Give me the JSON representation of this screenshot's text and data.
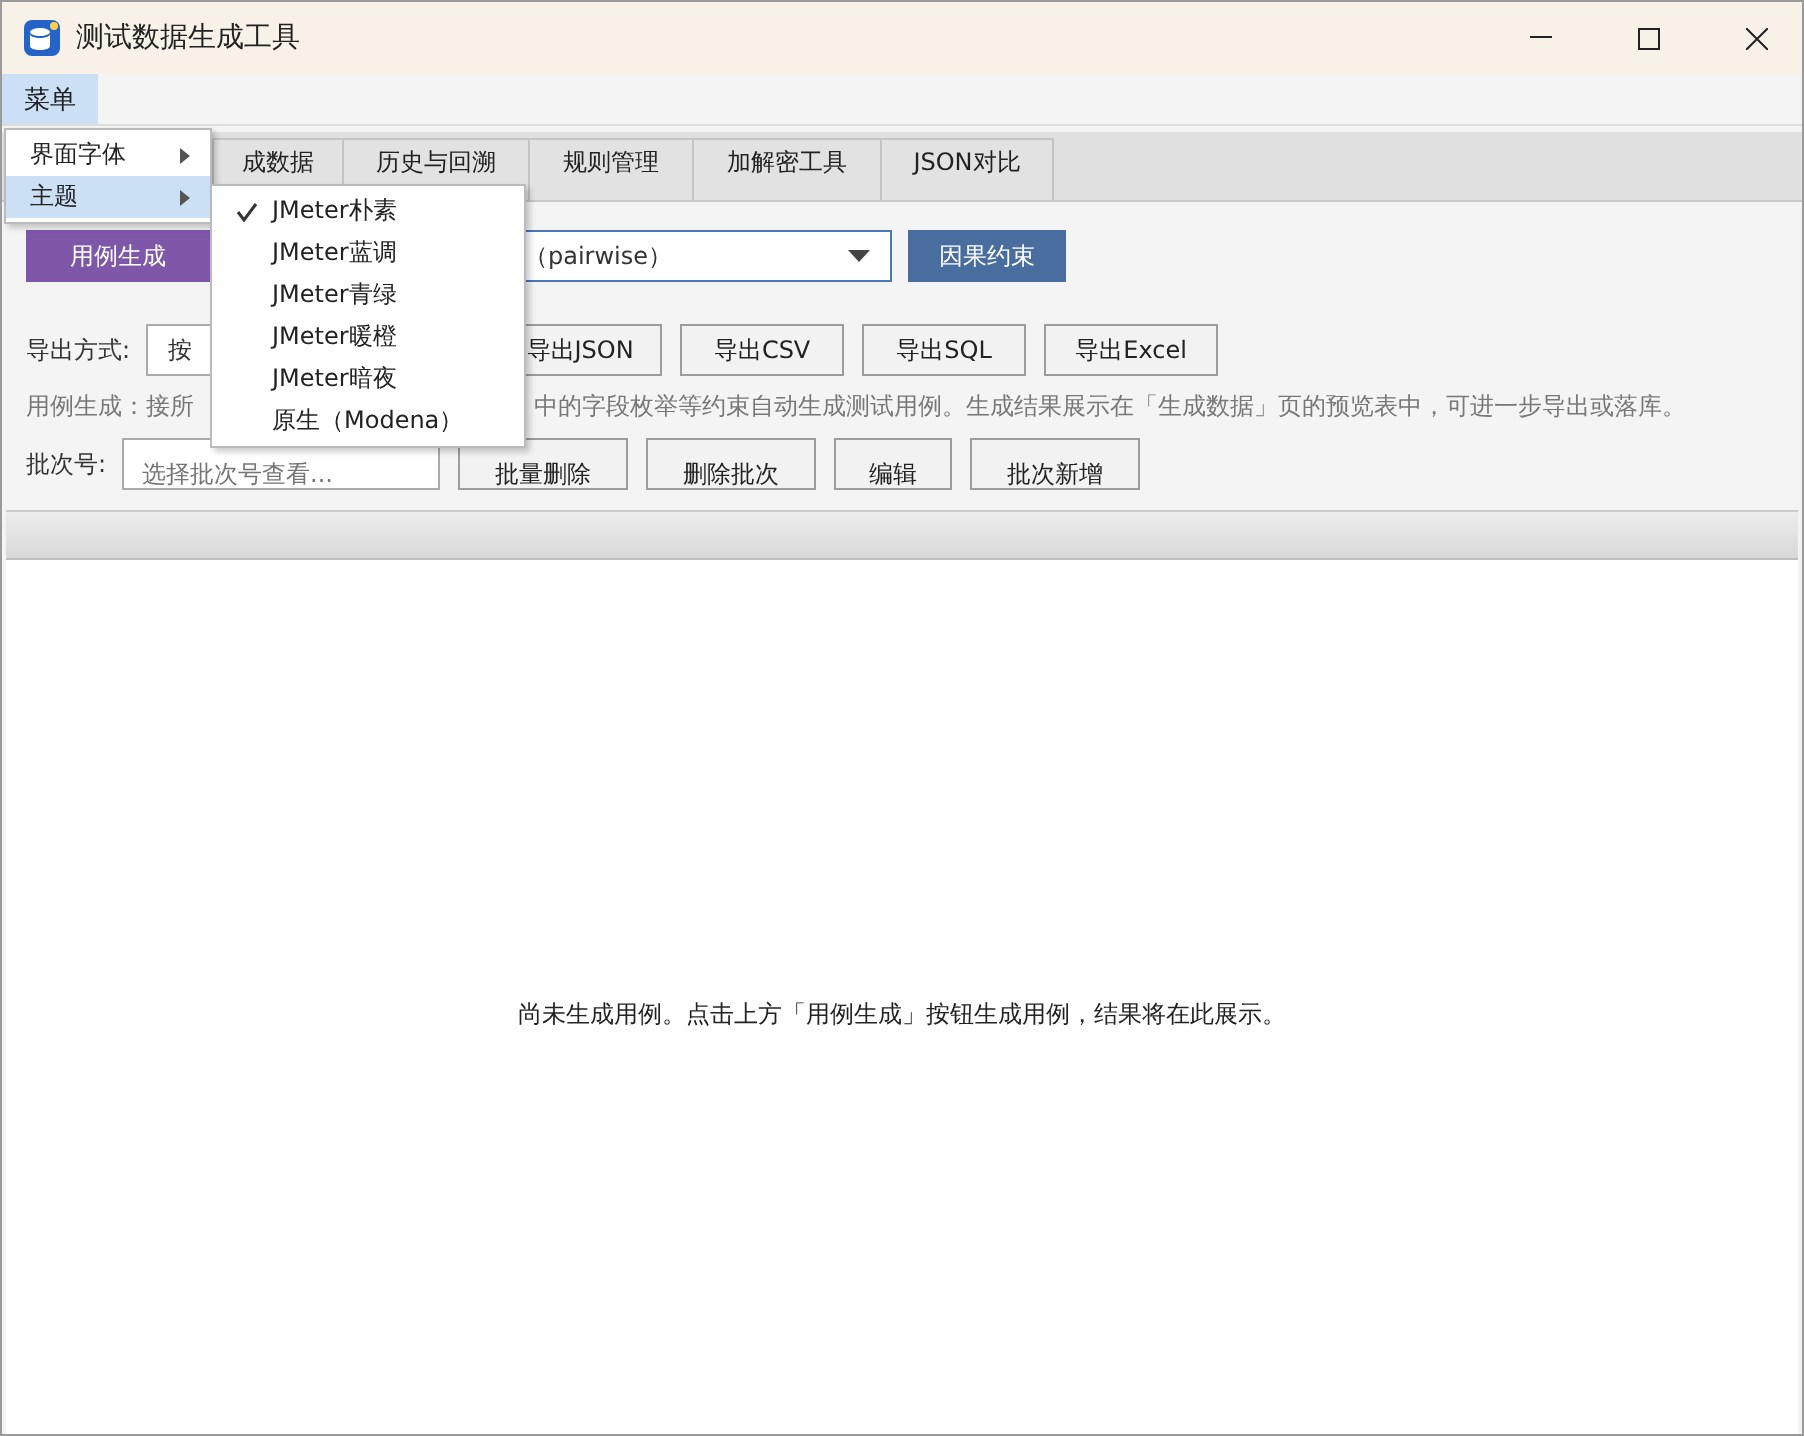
{
  "window": {
    "title": "测试数据生成工具"
  },
  "menubar": [
    {
      "label": "菜单",
      "selected": true
    }
  ],
  "menu": {
    "items": [
      {
        "label": "界面字体",
        "selected": false
      },
      {
        "label": "主题",
        "selected": true
      }
    ],
    "submenu": [
      {
        "label": "JMeter朴素",
        "checked": true
      },
      {
        "label": "JMeter蓝调",
        "checked": false
      },
      {
        "label": "JMeter青绿",
        "checked": false
      },
      {
        "label": "JMeter暖橙",
        "checked": false
      },
      {
        "label": "JMeter暗夜",
        "checked": false
      },
      {
        "label": "原生（Modena）",
        "checked": false
      }
    ]
  },
  "tabs": [
    {
      "label": "成数据",
      "selected": false
    },
    {
      "label": "历史与回溯",
      "selected": false
    },
    {
      "label": "规则管理",
      "selected": false
    },
    {
      "label": "加解密工具",
      "selected": false
    },
    {
      "label": "JSON对比",
      "selected": false
    }
  ],
  "generate_row": {
    "generate_button": "用例生成",
    "strategy_value": "（pairwise）",
    "constraint_button": "因果约束"
  },
  "export_row": {
    "label": "导出方式:",
    "mode_value": "按",
    "buttons": [
      "导出JSON",
      "导出CSV",
      "导出SQL",
      "导出Excel"
    ]
  },
  "description": {
    "start": "用例生成：接所",
    "end": "中的字段枚举等约束自动生成测试用例。生成结果展示在「生成数据」页的预览表中，可进一步导出或落库。"
  },
  "batch_row": {
    "label": "批次号:",
    "placeholder": "选择批次号查看...",
    "buttons": [
      "批量删除",
      "删除批次",
      "编辑",
      "批次新增"
    ]
  },
  "table": {
    "empty_message": "尚未生成用例。点击上方「用例生成」按钮生成用例，结果将在此展示。"
  }
}
